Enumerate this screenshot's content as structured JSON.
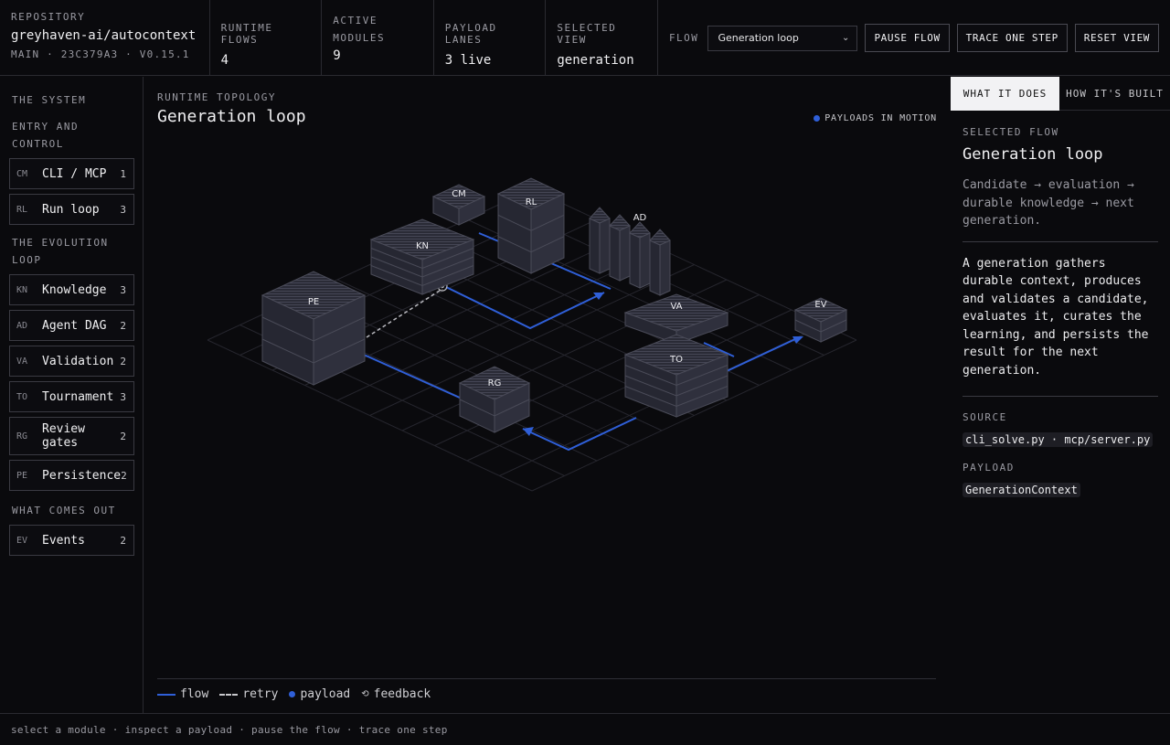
{
  "header": {
    "repository": {
      "caption": "REPOSITORY",
      "name": "greyhaven-ai/autocontext",
      "meta": "MAIN · 23C379A3 · V0.15.1"
    },
    "stats": [
      {
        "caption": "RUNTIME FLOWS",
        "value": "4"
      },
      {
        "caption": "ACTIVE MODULES",
        "value": "9"
      },
      {
        "caption": "PAYLOAD LANES",
        "value": "3 live"
      },
      {
        "caption": "SELECTED VIEW",
        "value": "generation"
      }
    ],
    "flow_caption": "FLOW",
    "flow_select": "Generation loop",
    "buttons": {
      "pause": "PAUSE FLOW",
      "trace": "TRACE ONE STEP",
      "reset": "RESET VIEW"
    }
  },
  "sidebar": {
    "groups": {
      "system": "THE SYSTEM",
      "entry": "ENTRY AND CONTROL",
      "evolution": "THE EVOLUTION LOOP",
      "out": "WHAT COMES OUT"
    },
    "modules": [
      {
        "abbr": "CM",
        "name": "CLI / MCP",
        "count": "1"
      },
      {
        "abbr": "RL",
        "name": "Run loop",
        "count": "3"
      },
      {
        "abbr": "KN",
        "name": "Knowledge",
        "count": "3"
      },
      {
        "abbr": "AD",
        "name": "Agent DAG",
        "count": "2"
      },
      {
        "abbr": "VA",
        "name": "Validation",
        "count": "2"
      },
      {
        "abbr": "TO",
        "name": "Tournament",
        "count": "3"
      },
      {
        "abbr": "RG",
        "name": "Review gates",
        "count": "2"
      },
      {
        "abbr": "PE",
        "name": "Persistence",
        "count": "2"
      },
      {
        "abbr": "EV",
        "name": "Events",
        "count": "2"
      }
    ]
  },
  "topology": {
    "caption": "RUNTIME TOPOLOGY",
    "title": "Generation loop",
    "motion_label": "PAYLOADS IN MOTION",
    "node_labels": [
      "CM",
      "RL",
      "KN",
      "AD",
      "PE",
      "VA",
      "EV",
      "TO",
      "RG"
    ],
    "legend": {
      "flow": "flow",
      "retry": "retry",
      "payload": "payload",
      "feedback": "feedback"
    },
    "colors": {
      "flow": "#2f5fd8",
      "node_face": "#2c2d38",
      "grid": "#2a2a32"
    }
  },
  "details": {
    "tabs": {
      "active": "WHAT IT DOES",
      "other": "HOW IT'S BUILT"
    },
    "selected_caption": "SELECTED FLOW",
    "selected_title": "Generation loop",
    "summary": "Candidate → evaluation → durable knowledge → next generation.",
    "body": "A generation gathers durable context, produces and validates a candidate, evaluates it, curates the learning, and persists the result for the next generation.",
    "source_caption": "SOURCE",
    "source": "cli_solve.py · mcp/server.py",
    "payload_caption": "PAYLOAD",
    "payload": "GenerationContext"
  },
  "footer": "select a module · inspect a payload · pause the flow · trace one step"
}
